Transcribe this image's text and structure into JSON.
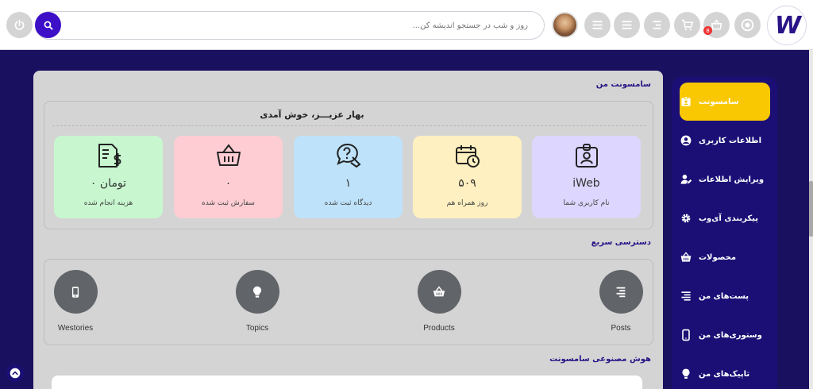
{
  "header": {
    "logo_text": "W",
    "search_placeholder": "روز و شب در جستجو اندیشه کن...",
    "cart_badge": "8",
    "colors": {
      "accent": "#3d10c8",
      "brand": "#1b0f76"
    }
  },
  "sidebar": {
    "items": [
      {
        "label": "سامسونت",
        "icon": "id-badge-icon",
        "active": true
      },
      {
        "label": "اطلاعات کاربری",
        "icon": "user-circle-icon"
      },
      {
        "label": "ویرایش اطلاعات",
        "icon": "user-edit-icon"
      },
      {
        "label": "پیکربندی آی‌وب",
        "icon": "gear-icon"
      },
      {
        "label": "محصولات",
        "icon": "basket-icon"
      },
      {
        "label": "پست‌های من",
        "icon": "posts-icon"
      },
      {
        "label": "وستوری‌های من",
        "icon": "mobile-icon"
      },
      {
        "label": "تاپیک‌های من",
        "icon": "lightbulb-icon"
      }
    ],
    "active_color": "#f9c802"
  },
  "main": {
    "section_title": "سامسونت من",
    "welcome": "بهار عزیـــز، خوش آمدی",
    "stats": [
      {
        "value": "iWeb",
        "label": "نام کاربری شما",
        "color": "#ddd6fe",
        "icon": "user-badge-icon"
      },
      {
        "value": "۵۰۹",
        "label": "روز همراه هم",
        "color": "#fef0c0",
        "icon": "calendar-clock-icon"
      },
      {
        "value": "۱",
        "label": "دیدگاه ثبت شده",
        "color": "#bfe2fb",
        "icon": "comment-question-icon"
      },
      {
        "value": "۰",
        "label": "سفارش ثبت شده",
        "color": "#fecdd3",
        "icon": "basket-icon"
      },
      {
        "value": "۰ تومان",
        "label": "هزینه انجام شده",
        "color": "#c8f7cf",
        "icon": "invoice-dollar-icon"
      }
    ],
    "quick_title": "دسترسی سریع",
    "quick_access": [
      {
        "label": "Posts",
        "icon": "posts-icon"
      },
      {
        "label": "Products",
        "icon": "basket-icon"
      },
      {
        "label": "Topics",
        "icon": "lightbulb-icon"
      },
      {
        "label": "Westories",
        "icon": "mobile-icon"
      }
    ],
    "ai_title": "هوش مصنوعی سامسونت"
  }
}
